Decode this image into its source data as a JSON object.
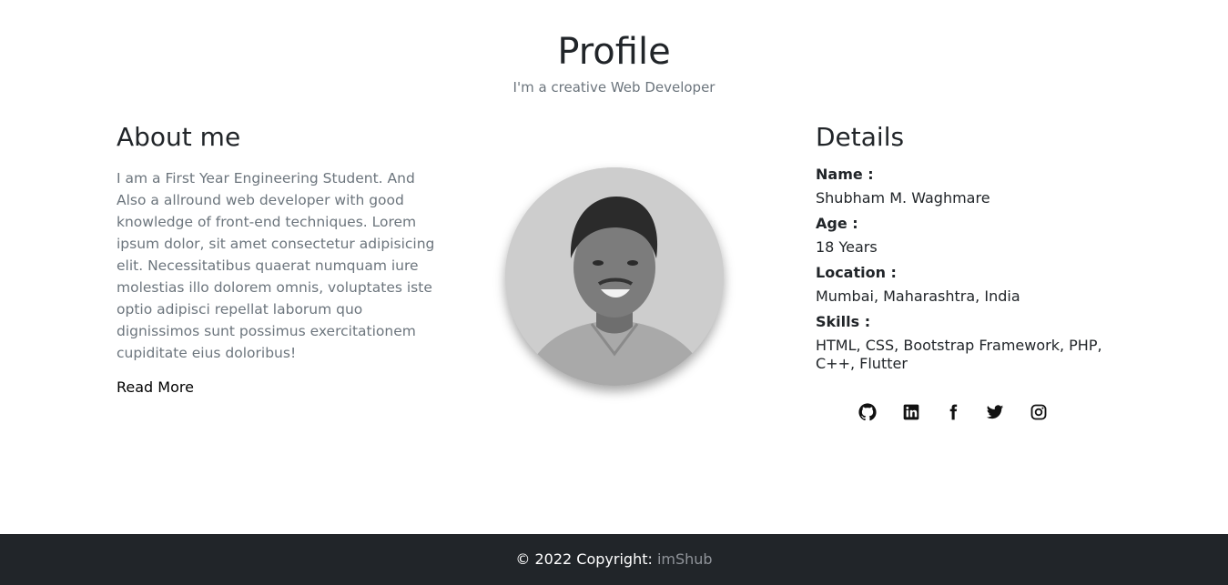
{
  "header": {
    "title": "Profile",
    "subtitle": "I'm a creative Web Developer"
  },
  "about": {
    "heading": "About me",
    "text": "I am a First Year Engineering Student. And Also a allround web developer with good knowledge of front-end techniques. Lorem ipsum dolor, sit amet consectetur adipisicing elit. Necessitatibus quaerat numquam iure molestias illo dolorem omnis, voluptates iste optio adipisci repellat laborum quo dignissimos sunt possimus exercitationem cupiditate eius doloribus!",
    "read_more": "Read More"
  },
  "details": {
    "heading": "Details",
    "items": [
      {
        "label": "Name :",
        "value": "Shubham M. Waghmare"
      },
      {
        "label": "Age :",
        "value": "18 Years"
      },
      {
        "label": "Location :",
        "value": "Mumbai, Maharashtra, India"
      },
      {
        "label": "Skills :",
        "value": "HTML, CSS, Bootstrap Framework, PHP, C++, Flutter"
      }
    ]
  },
  "social": [
    "github-icon",
    "linkedin-icon",
    "facebook-icon",
    "twitter-icon",
    "instagram-icon"
  ],
  "footer": {
    "text": "© 2022 Copyright: ",
    "brand": "imShub"
  },
  "colors": {
    "text": "#212529",
    "muted": "#6c757d",
    "footer_bg": "#212529",
    "footer_brand": "#8f9399"
  }
}
